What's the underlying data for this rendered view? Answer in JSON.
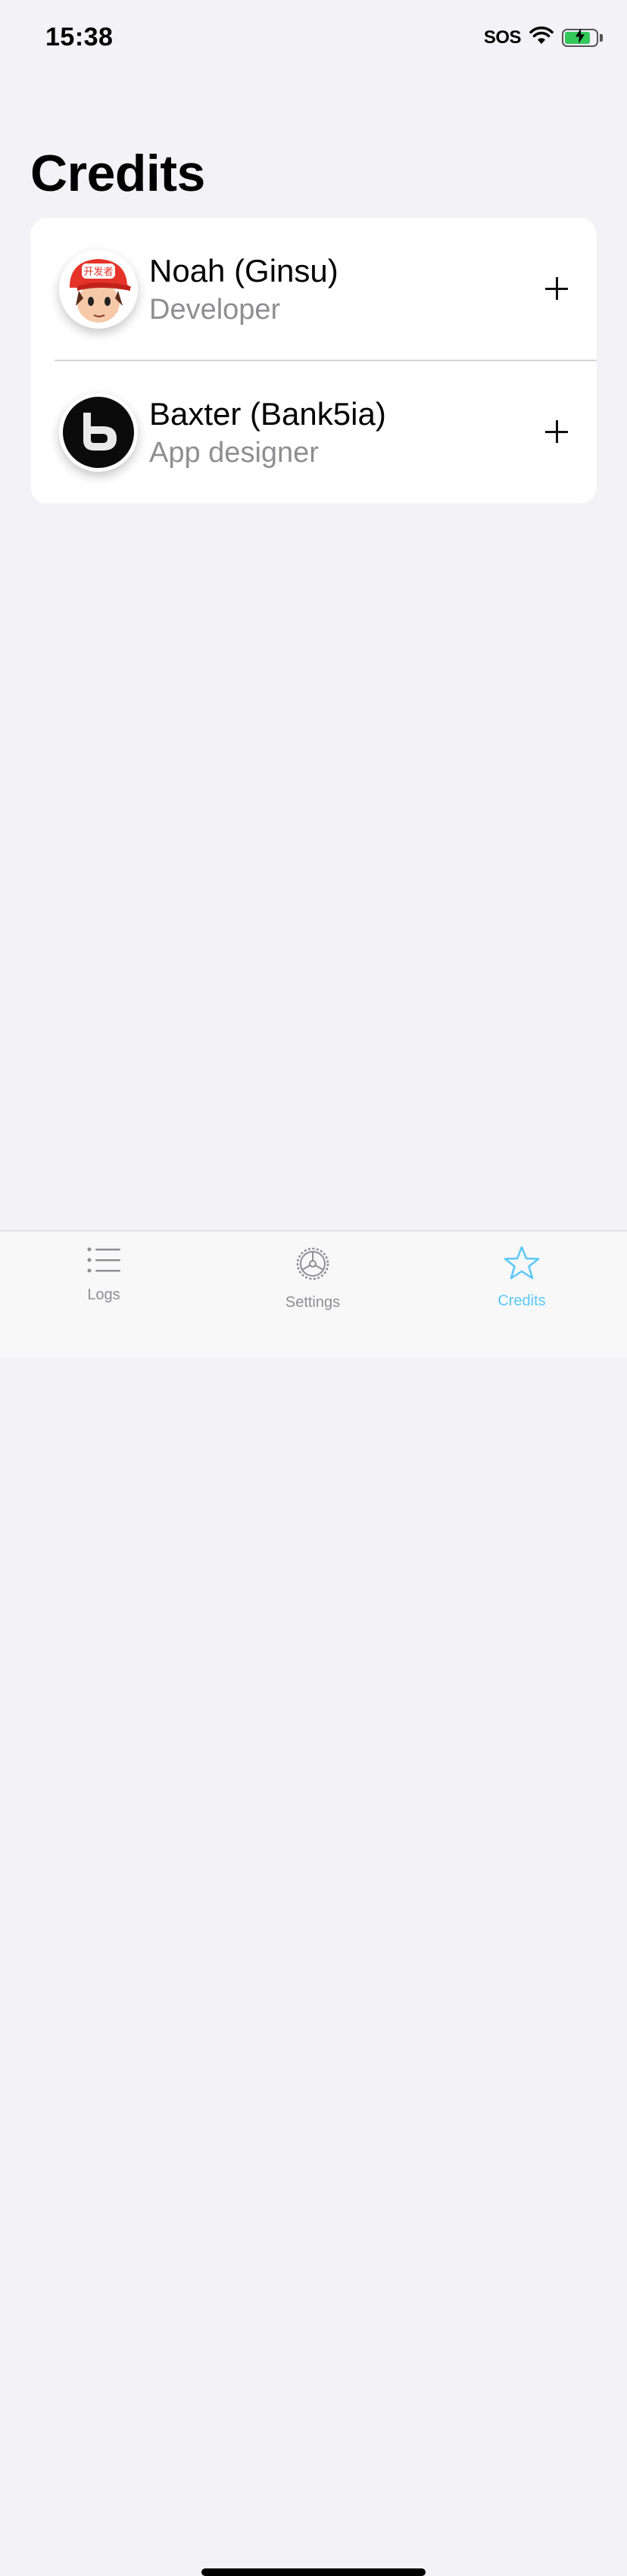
{
  "status_bar": {
    "time": "15:38",
    "carrier": "SOS",
    "icons": [
      "wifi-icon",
      "battery-charging-icon"
    ],
    "battery_color": "#34c759",
    "battery_level": 0.85
  },
  "page": {
    "title": "Credits"
  },
  "credits": [
    {
      "name": "Noah (Ginsu)",
      "role": "Developer",
      "avatar_badge": "开发者",
      "action_icon": "plus-icon"
    },
    {
      "name": "Baxter (Bank5ia)",
      "role": "App designer",
      "action_icon": "plus-icon"
    }
  ],
  "tabbar": {
    "active_color": "#5ac8fa",
    "inactive_color": "#8e8e93",
    "tabs": [
      {
        "label": "Logs",
        "icon": "list-icon",
        "active": false
      },
      {
        "label": "Settings",
        "icon": "gear-icon",
        "active": false
      },
      {
        "label": "Credits",
        "icon": "star-icon",
        "active": true
      }
    ]
  }
}
